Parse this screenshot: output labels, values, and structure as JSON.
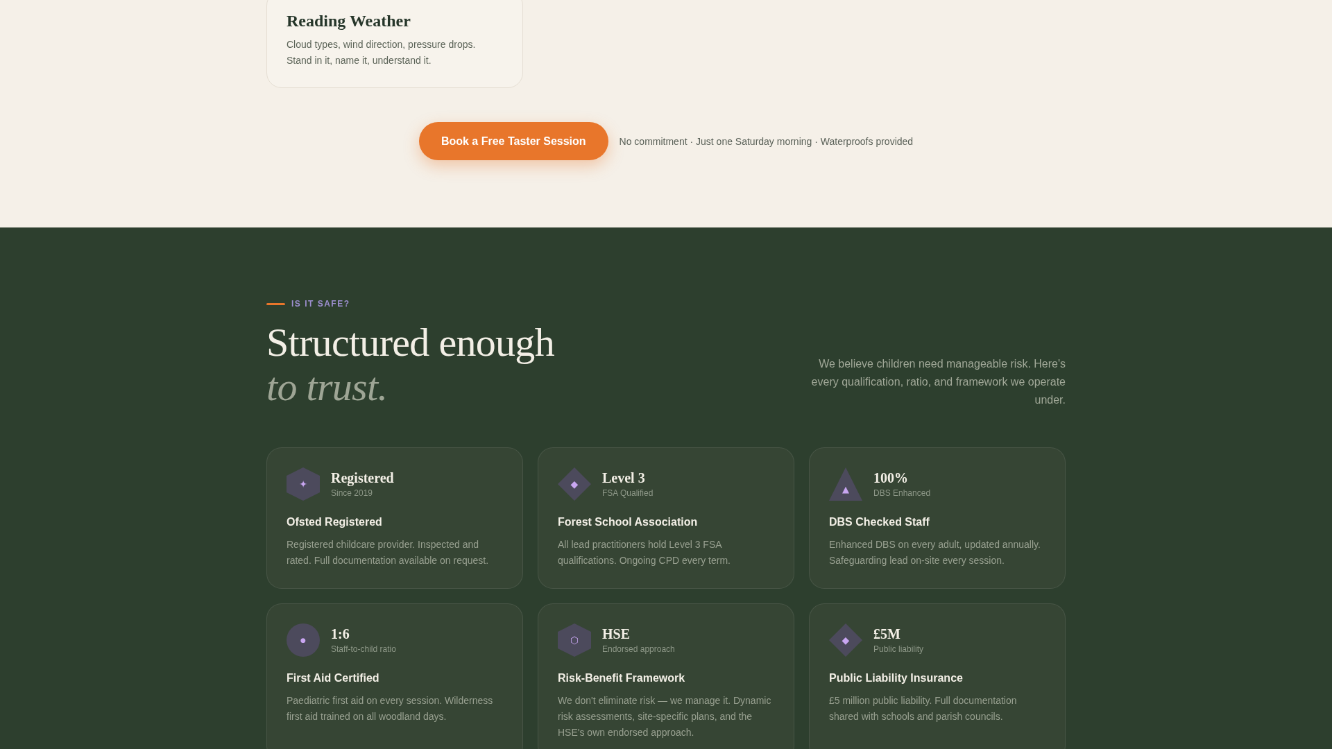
{
  "activities": [
    {
      "title": "Reading Weather",
      "text": "Cloud types, wind direction, pressure drops. Stand in it, name it, understand it."
    }
  ],
  "cta": {
    "button": "Book a Free Taster Session",
    "note": "No commitment · Just one Saturday morning · Waterproofs provided"
  },
  "safety": {
    "eyebrow": "IS IT SAFE?",
    "heading": "Structured enough *to trust.*",
    "intro": "We believe children need manageable risk. Here's every qualification, ratio, and framework we operate under.",
    "cards": [
      {
        "kind": "hexagon",
        "icon": "✦",
        "stat": "Registered",
        "stat_label": "Since 2019",
        "title": "Ofsted Registered",
        "text": "Registered childcare provider. Inspected and rated. Full documentation available on request."
      },
      {
        "kind": "diamond",
        "icon": "◆",
        "stat": "Level 3",
        "stat_label": "FSA Qualified",
        "title": "Forest School Association",
        "text": "All lead practitioners hold Level 3 FSA qualifications. Ongoing CPD every term."
      },
      {
        "kind": "triangle",
        "icon": "▲",
        "stat": "100%",
        "stat_label": "DBS Enhanced",
        "title": "DBS Checked Staff",
        "text": "Enhanced DBS on every adult, updated annually. Safeguarding lead on-site every session."
      },
      {
        "kind": "circle",
        "icon": "●",
        "stat": "1:6",
        "stat_label": "Staff-to-child ratio",
        "title": "First Aid Certified",
        "text": "Paediatric first aid on every session. Wilderness first aid trained on all woodland days."
      },
      {
        "kind": "hexagon",
        "icon": "⬡",
        "stat": "HSE",
        "stat_label": "Endorsed approach",
        "title": "Risk-Benefit Framework",
        "text": "We don't eliminate risk — we manage it. Dynamic risk assessments, site-specific plans, and the HSE's own endorsed approach."
      },
      {
        "kind": "diamond",
        "icon": "◆",
        "stat": "£5M",
        "stat_label": "Public liability",
        "title": "Public Liability Insurance",
        "text": "£5 million public liability. Full documentation shared with schools and parish councils."
      }
    ]
  }
}
